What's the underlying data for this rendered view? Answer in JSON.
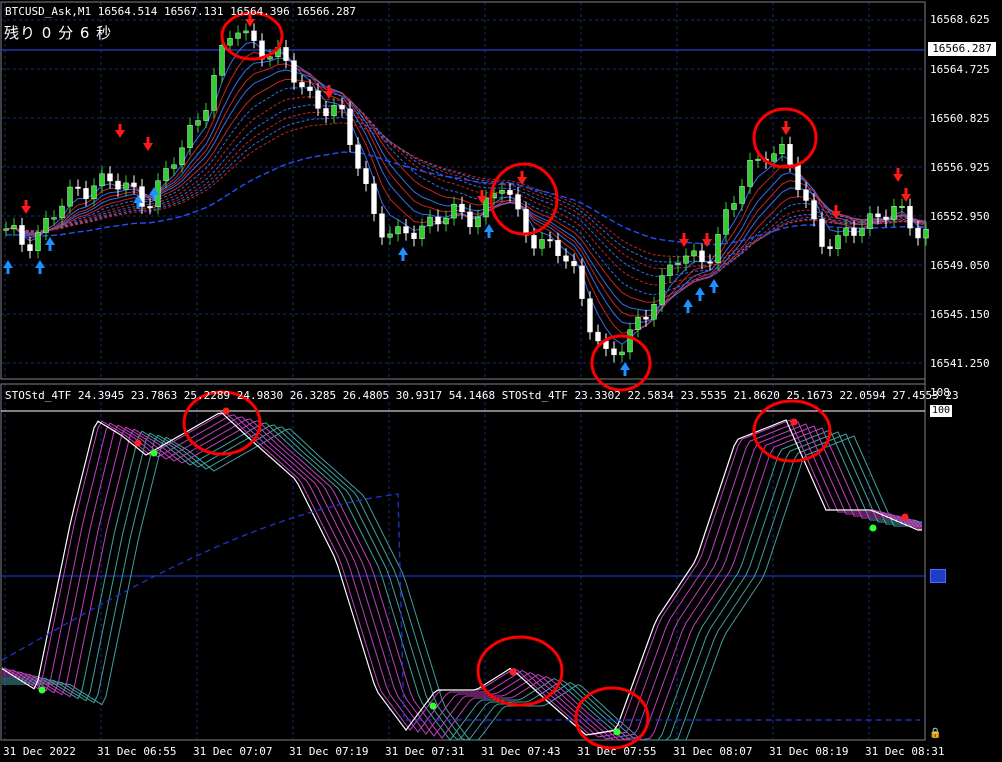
{
  "window": {
    "symbol_header": "BTCUSD_Ask,M1  16564.514 16567.131 16564.396 16566.287",
    "remaining_text": "残り 0 分 6 秒"
  },
  "price_axis": {
    "ticks": [
      "16568.625",
      "16564.725",
      "16560.825",
      "16556.925",
      "16552.950",
      "16549.050",
      "16545.150",
      "16541.250"
    ],
    "current_price": "16566.287"
  },
  "oscillator": {
    "header": "STOStd_4TF 24.3945 23.7863 25.2289 24.9830 26.3285 26.4805 30.9317 54.1468  STOStd_4TF 23.3302 22.5834 23.5535 21.8620 25.1673 22.0594 27.4553 23",
    "axis_top": "108",
    "axis_level": "100"
  },
  "time_axis": {
    "ticks": [
      "31 Dec 2022",
      "31 Dec 06:55",
      "31 Dec 07:07",
      "31 Dec 07:19",
      "31 Dec 07:31",
      "31 Dec 07:43",
      "31 Dec 07:55",
      "31 Dec 08:07",
      "31 Dec 08:19",
      "31 Dec 08:31"
    ]
  },
  "colors": {
    "background": "#000000",
    "bull_candle": "#32cd32",
    "bear_candle": "#ffffff",
    "ribbon_fast": "#dc2828",
    "ribbon_slow": "#3c78ff",
    "sell_arrow": "#ff1a1a",
    "buy_arrow": "#1e90ff",
    "annotation_circle": "#ff0000",
    "osc_magenta": "#c040c0",
    "osc_teal": "#40a0a0",
    "grid": "#1c2a78"
  },
  "icons": {
    "sell_signal": "down-arrow-icon",
    "buy_signal": "up-arrow-icon",
    "lock": "lock-icon"
  },
  "chart_data": {
    "type": "candlestick",
    "instrument": "BTCUSD_Ask,M1",
    "ohlc_header": {
      "open": 16564.514,
      "high": 16567.131,
      "low": 16564.396,
      "close": 16566.287
    },
    "price_path": [
      16551.5,
      16551.0,
      16552.0,
      16553.5,
      16555.0,
      16556.0,
      16555.5,
      16555.0,
      16554.5,
      16556.0,
      16558.5,
      16561.5,
      16565.0,
      16568.0,
      16567.0,
      16566.0,
      16564.5,
      16563.0,
      16561.8,
      16560.5,
      16557.0,
      16552.5,
      16550.8,
      16552.0,
      16552.8,
      16553.0,
      16552.7,
      16554.0,
      16555.5,
      16552.5,
      16551.3,
      16550.5,
      16548.5,
      16545.0,
      16541.5,
      16542.5,
      16545.5,
      16547.5,
      16549.5,
      16549.8,
      16550.5,
      16553.5,
      16557.0,
      16558.5,
      16557.5,
      16555.0,
      16551.5,
      16550.5,
      16552.0,
      16553.2,
      16553.5,
      16552.2,
      16552.0
    ],
    "ylim": [
      16539.5,
      16570.0
    ],
    "signals_sell": 13,
    "signals_buy": 11,
    "oscillator_levels": [
      100,
      50
    ]
  }
}
